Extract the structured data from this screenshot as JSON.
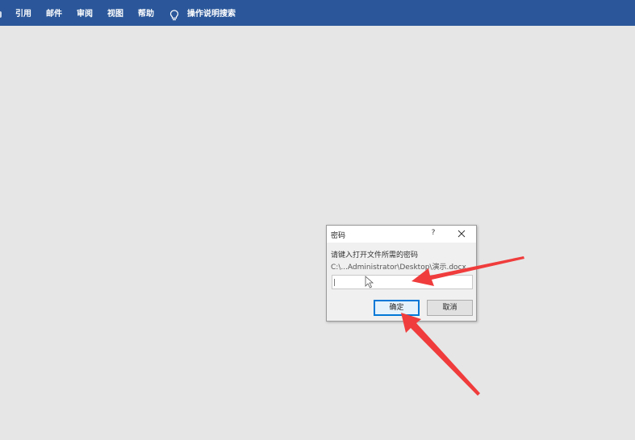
{
  "ribbon": {
    "tabs": [
      "引用",
      "邮件",
      "审阅",
      "视图",
      "帮助"
    ],
    "tell_me": "操作说明搜索",
    "tell_me_icon": "lightbulb-icon",
    "background": "#2b579a"
  },
  "dialog": {
    "title": "密码",
    "help": "?",
    "close_icon": "close-icon",
    "prompt": "请键入打开文件所需的密码",
    "path": "C:\\...Administrator\\Desktop\\演示.docx",
    "password_value": "",
    "ok_label": "确定",
    "cancel_label": "取消"
  },
  "annotations": {
    "arrow_color": "#f03c3c"
  }
}
